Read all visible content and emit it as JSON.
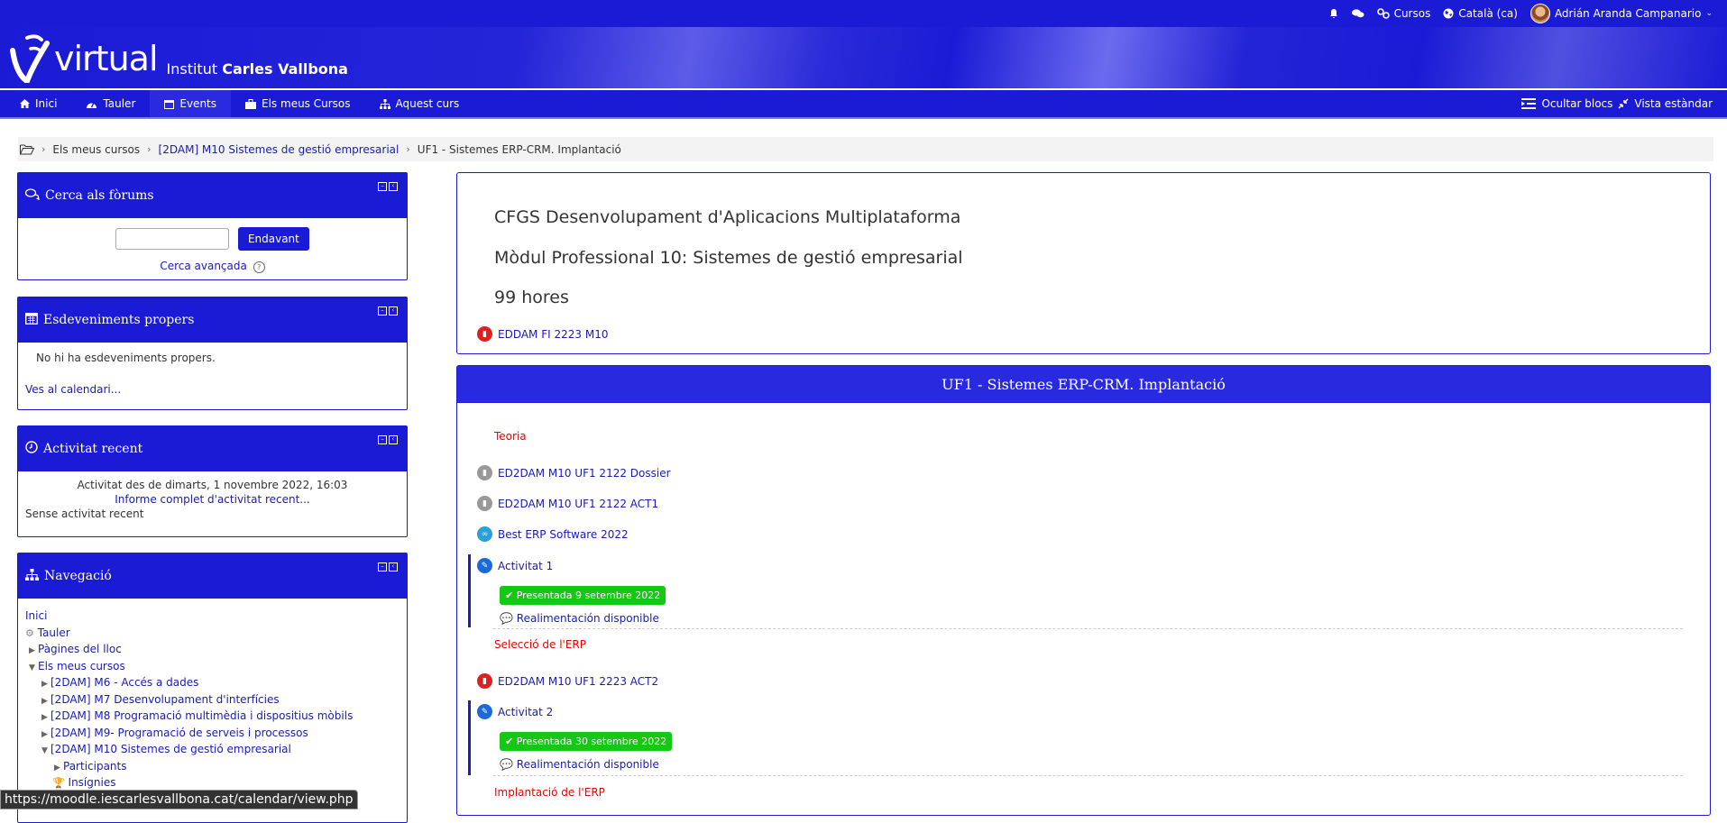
{
  "topbar": {
    "courses_label": "Cursos",
    "language": "Català (ca)",
    "user_name": "Adrián Aranda Campanario"
  },
  "banner": {
    "logo_text": "virtual",
    "institute_prefix": "Institut",
    "institute_name": "Carles Vallbona"
  },
  "nav": {
    "items": [
      {
        "label": "Inici",
        "icon": "home-icon"
      },
      {
        "label": "Tauler",
        "icon": "dashboard-icon"
      },
      {
        "label": "Events",
        "icon": "calendar-icon"
      },
      {
        "label": "Els meus Cursos",
        "icon": "briefcase-icon"
      },
      {
        "label": "Aquest curs",
        "icon": "sitemap-icon"
      }
    ],
    "hide_blocks": "Ocultar blocs",
    "standard_view": "Vista estàndar"
  },
  "breadcrumb": {
    "items": [
      "Els meus cursos",
      "[2DAM] M10 Sistemes de gestió empresarial",
      "UF1 - Sistemes ERP-CRM. Implantació"
    ]
  },
  "blocks": {
    "forum_search": {
      "title": "Cerca als fòrums",
      "button": "Endavant",
      "advanced": "Cerca avançada"
    },
    "upcoming": {
      "title": "Esdeveniments propers",
      "empty": "No hi ha esdeveniments propers.",
      "calendar_link": "Ves al calendari..."
    },
    "recent": {
      "title": "Activitat recent",
      "since": "Activitat des de dimarts, 1 novembre 2022, 16:03",
      "full_report": "Informe complet d'activitat recent...",
      "none": "Sense activitat recent"
    },
    "navigation": {
      "title": "Navegació",
      "items": [
        "Inici",
        "Tauler",
        "Pàgines del lloc",
        "Els meus cursos",
        "[2DAM] M6 - Accés a dades",
        "[2DAM] M7 Desenvolupament d'interfícies",
        "[2DAM] M8 Programació multimèdia i dispositius mòbils",
        "[2DAM] M9- Programació de serveis i processos",
        "[2DAM] M10 Sistemes de gestió empresarial",
        "Participants",
        "Insígnies"
      ]
    }
  },
  "summary": {
    "line1": "CFGS Desenvolupament d'Aplicacions Multiplataforma",
    "line2": "Mòdul Professional 10: Sistemes de gestió empresarial",
    "line3": "99 hores",
    "file": "EDDAM FI 2223 M10"
  },
  "section": {
    "title": "UF1 - Sistemes ERP-CRM. Implantació",
    "label_theory": "Teoria",
    "act_dossier": "ED2DAM M10 UF1 2122 Dossier",
    "act_act1_file": "ED2DAM M10 UF1 2122 ACT1",
    "act_url": "Best ERP Software 2022",
    "act_1": "Activitat 1",
    "badge_1": "Presentada 9 setembre 2022",
    "feedback_1": "Realimentación disponible",
    "label_erp_selection": "Selecció de l'ERP",
    "act_act2_file": "ED2DAM M10 UF1 2223 ACT2",
    "act_2": "Activitat 2",
    "badge_2": "Presentada 30 setembre 2022",
    "feedback_2": "Realimentación disponible",
    "label_erp_impl": "Implantació de l'ERP"
  },
  "status_url": "https://moodle.iescarlesvallbona.cat/calendar/view.php",
  "colors": {
    "brand_blue": "#1b1bd6",
    "label_red": "#e00000",
    "submitted_green": "#14c814"
  }
}
